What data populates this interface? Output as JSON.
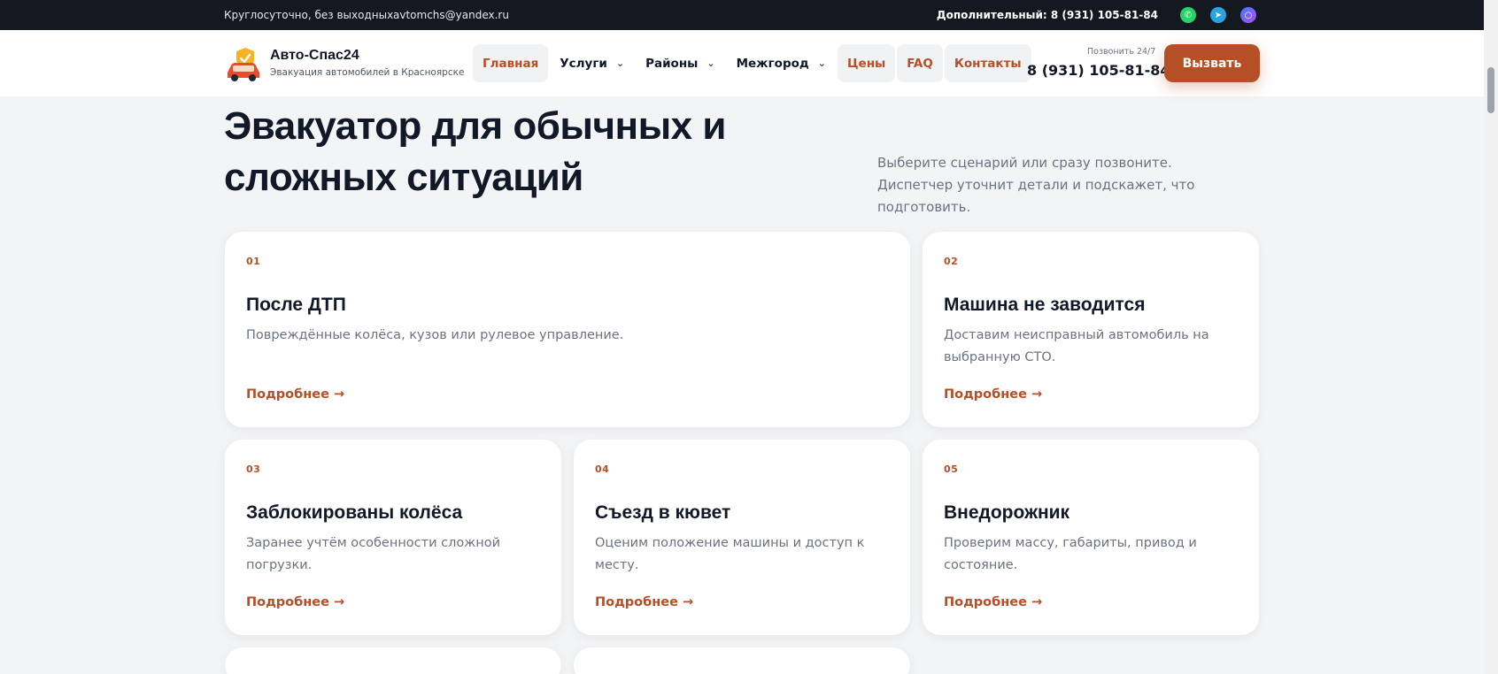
{
  "topbar": {
    "hours": "Круглосуточно, без выходных",
    "email": "avtomchs@yandex.ru",
    "extra_phone": "Дополнительный: 8 (931) 105-81-84",
    "socials": [
      "whatsapp-icon",
      "telegram-icon",
      "max-icon"
    ]
  },
  "header": {
    "brand": "Авто-Спас24",
    "tagline": "Эвакуация автомобилей в Красноярске",
    "nav": [
      {
        "label": "Главная",
        "dropdown": false
      },
      {
        "label": "Услуги",
        "dropdown": true
      },
      {
        "label": "Районы",
        "dropdown": true
      },
      {
        "label": "Межгород",
        "dropdown": true
      },
      {
        "label": "Цены",
        "dropdown": false
      },
      {
        "label": "FAQ",
        "dropdown": false
      },
      {
        "label": "Контакты",
        "dropdown": false
      }
    ],
    "call_hint": "Позвонить 24/7",
    "phone": "8 (931) 105-81-84",
    "cta": "Вызвать"
  },
  "hero": {
    "title": "Эвакуатор для обычных и сложных ситуаций",
    "subtitle": "Выберите сценарий или сразу позвоните. Диспетчер уточнит детали и подскажет, что подготовить."
  },
  "cards": [
    {
      "num": "01",
      "title": "После ДТП",
      "desc": "Повреждённые колёса, кузов или рулевое управление.",
      "more": "Подробнее →"
    },
    {
      "num": "02",
      "title": "Машина не заводится",
      "desc": "Доставим неисправный автомобиль на выбранную СТО.",
      "more": "Подробнее →"
    },
    {
      "num": "03",
      "title": "Заблокированы колёса",
      "desc": "Заранее учтём особенности сложной погрузки.",
      "more": "Подробнее →"
    },
    {
      "num": "04",
      "title": "Съезд в кювет",
      "desc": "Оценим положение машины и доступ к месту.",
      "more": "Подробнее →"
    },
    {
      "num": "05",
      "title": "Внедорожник",
      "desc": "Проверим массу, габариты, привод и состояние.",
      "more": "Подробнее →"
    }
  ],
  "colors": {
    "accent": "#b54f26",
    "topbar": "#141820",
    "background": "#f3f4f6"
  }
}
